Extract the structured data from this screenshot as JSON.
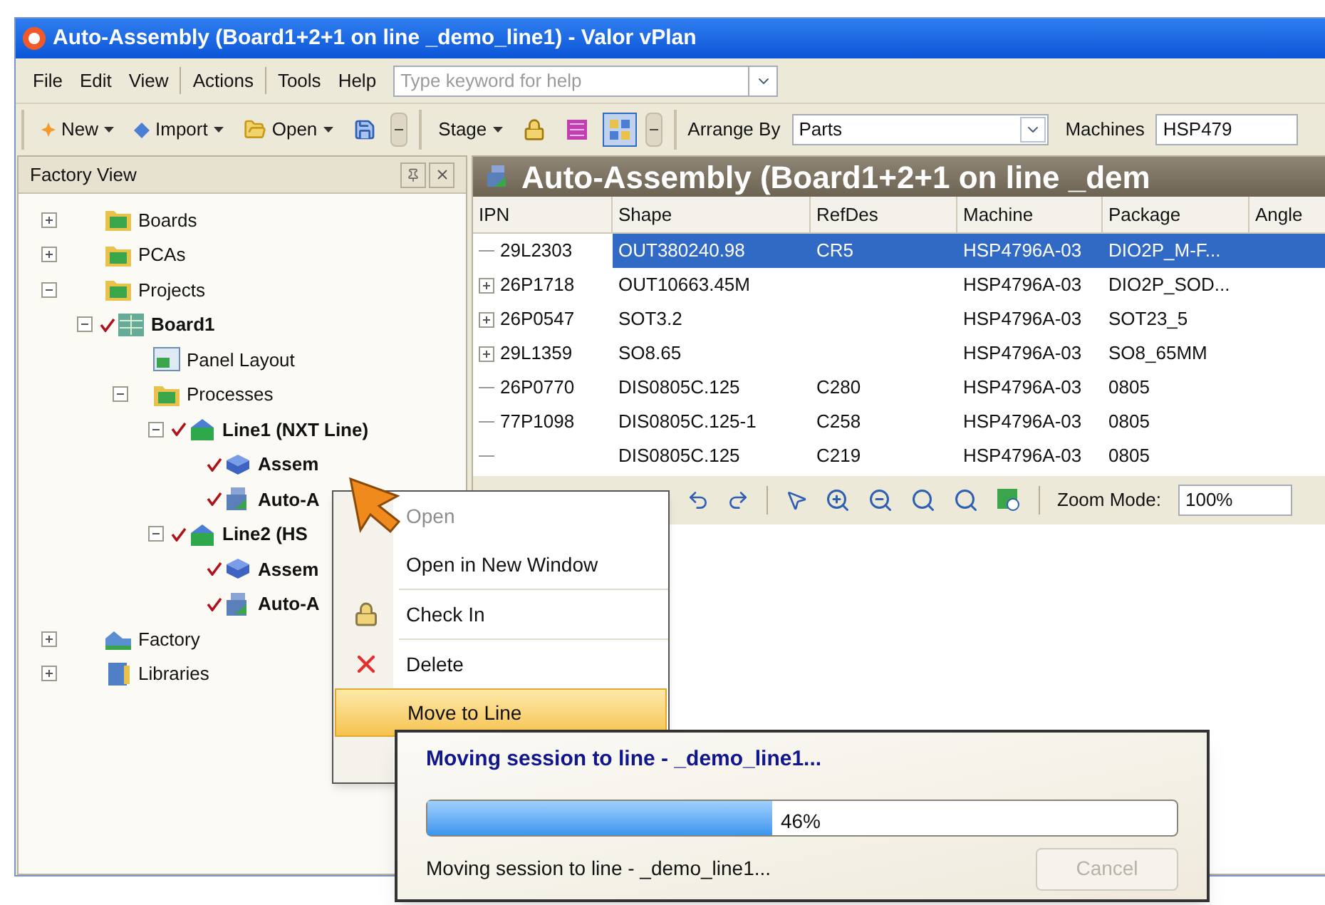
{
  "window": {
    "title": "Auto-Assembly (Board1+2+1 on line _demo_line1) - Valor vPlan"
  },
  "menu_bar": {
    "groups": [
      [
        "File",
        "Edit",
        "View"
      ],
      [
        "Actions"
      ],
      [
        "Tools",
        "Help"
      ]
    ],
    "help_search": {
      "placeholder": "Type keyword for help"
    }
  },
  "toolbar": {
    "groups": [
      [
        {
          "kind": "new",
          "label": "New"
        },
        {
          "kind": "import",
          "label": "Import"
        },
        {
          "kind": "open",
          "label": "Open"
        },
        {
          "kind": "save",
          "pressed": false
        }
      ],
      [
        {
          "kind": "stage",
          "label": "Stage"
        },
        {
          "kind": "lock",
          "pressed": false
        },
        {
          "kind": "chart",
          "pressed": false
        },
        {
          "kind": "grid",
          "pressed": true
        }
      ]
    ],
    "arrange_by": {
      "label": "Arrange By",
      "value": "Parts"
    },
    "machines": {
      "label": "Machines",
      "value": "HSP479"
    }
  },
  "factory_view": {
    "title": "Factory View",
    "tree": [
      {
        "label": "Boards",
        "kind": "folder",
        "expanded": false,
        "checked": false
      },
      {
        "label": "PCAs",
        "kind": "folder",
        "expanded": false,
        "checked": false
      },
      {
        "label": "Projects",
        "kind": "folder",
        "expanded": true,
        "checked": false,
        "children": [
          {
            "label": "Board1",
            "kind": "board",
            "expanded": true,
            "checked": true,
            "children": [
              {
                "label": "Panel Layout",
                "kind": "layout",
                "checked": false
              },
              {
                "label": "Processes",
                "kind": "folder",
                "expanded": true,
                "checked": false,
                "children": [
                  {
                    "label": "Line1 (NXT Line)",
                    "kind": "line",
                    "expanded": true,
                    "checked": true,
                    "children": [
                      {
                        "label": "Assem",
                        "kind": "assembly",
                        "checked": true
                      },
                      {
                        "label": "Auto-A",
                        "kind": "machine",
                        "checked": true
                      }
                    ]
                  },
                  {
                    "label": "Line2 (HS",
                    "kind": "line",
                    "expanded": true,
                    "checked": true,
                    "children": [
                      {
                        "label": "Assem",
                        "kind": "assembly",
                        "checked": true
                      },
                      {
                        "label": "Auto-A",
                        "kind": "machine",
                        "checked": true
                      }
                    ]
                  }
                ]
              }
            ]
          }
        ]
      },
      {
        "label": "Factory",
        "kind": "factory",
        "expanded": false,
        "checked": false
      },
      {
        "label": "Libraries",
        "kind": "library",
        "expanded": false,
        "checked": false
      }
    ]
  },
  "main": {
    "banner": "Auto-Assembly (Board1+2+1 on line _dem",
    "table": {
      "columns": [
        "IPN",
        "Shape",
        "RefDes",
        "Machine",
        "Package",
        "Angle"
      ],
      "rows": [
        {
          "kind": "leaf",
          "selected": true,
          "ipn": "29L2303",
          "shape": "OUT380240.98",
          "refdes": "CR5",
          "machine": "HSP4796A-03",
          "package": "DIO2P_M-F..."
        },
        {
          "kind": "group",
          "selected": false,
          "ipn": "26P1718",
          "shape": "OUT10663.45M",
          "machine": "HSP4796A-03",
          "package": "DIO2P_SOD..."
        },
        {
          "kind": "group",
          "selected": false,
          "ipn": "26P0547",
          "shape": "SOT3.2",
          "machine": "HSP4796A-03",
          "package": "SOT23_5"
        },
        {
          "kind": "group",
          "selected": false,
          "ipn": "29L1359",
          "shape": "SO8.65",
          "machine": "HSP4796A-03",
          "package": "SO8_65MM"
        },
        {
          "kind": "leaf",
          "selected": false,
          "ipn": "26P0770",
          "shape": "DIS0805C.125",
          "refdes": "C280",
          "machine": "HSP4796A-03",
          "package": "0805"
        },
        {
          "kind": "leaf",
          "selected": false,
          "ipn": "77P1098",
          "shape": "DIS0805C.125-1",
          "refdes": "C258",
          "machine": "HSP4796A-03",
          "package": "0805"
        },
        {
          "kind": "leaf",
          "selected": false,
          "shape": "DIS0805C.125",
          "refdes": "C219",
          "machine": "HSP4796A-03",
          "package": "0805"
        }
      ]
    },
    "view_toolbar": {
      "zoom_label": "Zoom Mode:",
      "zoom_value": "100%"
    }
  },
  "context_menu": {
    "items": [
      {
        "label": "Open",
        "kind": "plain",
        "disabled": true,
        "selected": false
      },
      {
        "label": "Open in New Window",
        "kind": "plain",
        "disabled": false,
        "selected": false
      },
      {
        "label": "Check In",
        "kind": "lock",
        "disabled": false,
        "selected": false
      },
      {
        "label": "Delete",
        "kind": "delete",
        "disabled": false,
        "selected": false
      },
      {
        "label": "Move to Line",
        "kind": "plain",
        "disabled": false,
        "selected": true
      }
    ]
  },
  "progress_dialog": {
    "title": "Moving session to line - _demo_line1...",
    "level": 0.46,
    "reading": "46%",
    "message": "Moving session to line - _demo_line1...",
    "cancel": {
      "label": "Cancel",
      "disabled": true
    }
  }
}
